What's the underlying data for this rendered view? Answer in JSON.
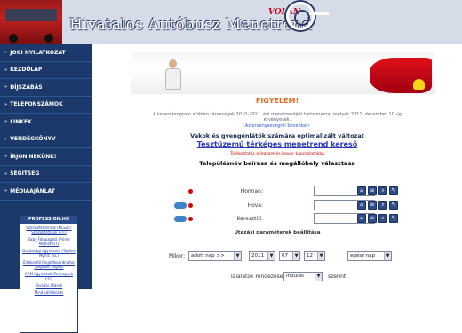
{
  "header": {
    "title": "Hivatalos Autóbusz Menetrend",
    "brand": "VOLÁN"
  },
  "sidebar": {
    "items": [
      {
        "label": "JOGI NYILATKOZAT"
      },
      {
        "label": "KEZDŐLAP"
      },
      {
        "label": "DÍJSZABÁS"
      },
      {
        "label": "TELEFONSZÁMOK"
      },
      {
        "label": "LINKEK"
      },
      {
        "label": "VENDÉGKÖNYV"
      },
      {
        "label": "ÍRJON NEKÜNK!"
      },
      {
        "label": "SEGÍTSÉG"
      },
      {
        "label": "MÉDIAAJÁNLAT"
      }
    ],
    "promo": {
      "title": "PROFESSION.HU",
      "links": [
        "Szervizfőmérnök (MLSZT) Szolgáltatások (FIT)",
        "Baby Főigazgató (Prime Market FIT)",
        "Gazdasági ügyvezető (Tagline Mgmt, ISC)",
        "Értékesítő Projektkoordinátor (Digitalis Logisz)",
        "CAM ügyintéző (Pannopark FIT)",
        "További állások",
        "Mind vállalkozás"
      ]
    }
  },
  "main": {
    "warning_title": "FIGYELEM!",
    "notice": "A keresőprogram a Volán társaságok 2010-2011. évi menetrendjeit tartalmazza, melyek 2011. december 10.-ig érvényesek.",
    "notice_link": "Az érvényességről bővebben",
    "optimized": "Vakok és gyengénlátók számára optimalizált változat",
    "test_link": "Tesztüzemű térképes menetrend kereső",
    "red_warning": "Tájékoztatás a Jegyzet és jegyár kapcsolatokba",
    "section_title": "Településnév beírása és megállóhely választása"
  },
  "form": {
    "rows": [
      {
        "label": "Honnan:",
        "value": ""
      },
      {
        "label": "Hova:",
        "value": ""
      },
      {
        "label": "Keresztül:",
        "value": ""
      }
    ],
    "params_title": "Utazási paraméterek beállítása",
    "mikor_label": "Mikor:",
    "mikor_value": "adott nap >>",
    "year": "2011",
    "month": "07",
    "day": "12",
    "daytime": "egész nap",
    "tal_label": "Találatok rendezése",
    "tal_value": "Indulás",
    "szerint": "szerint"
  }
}
